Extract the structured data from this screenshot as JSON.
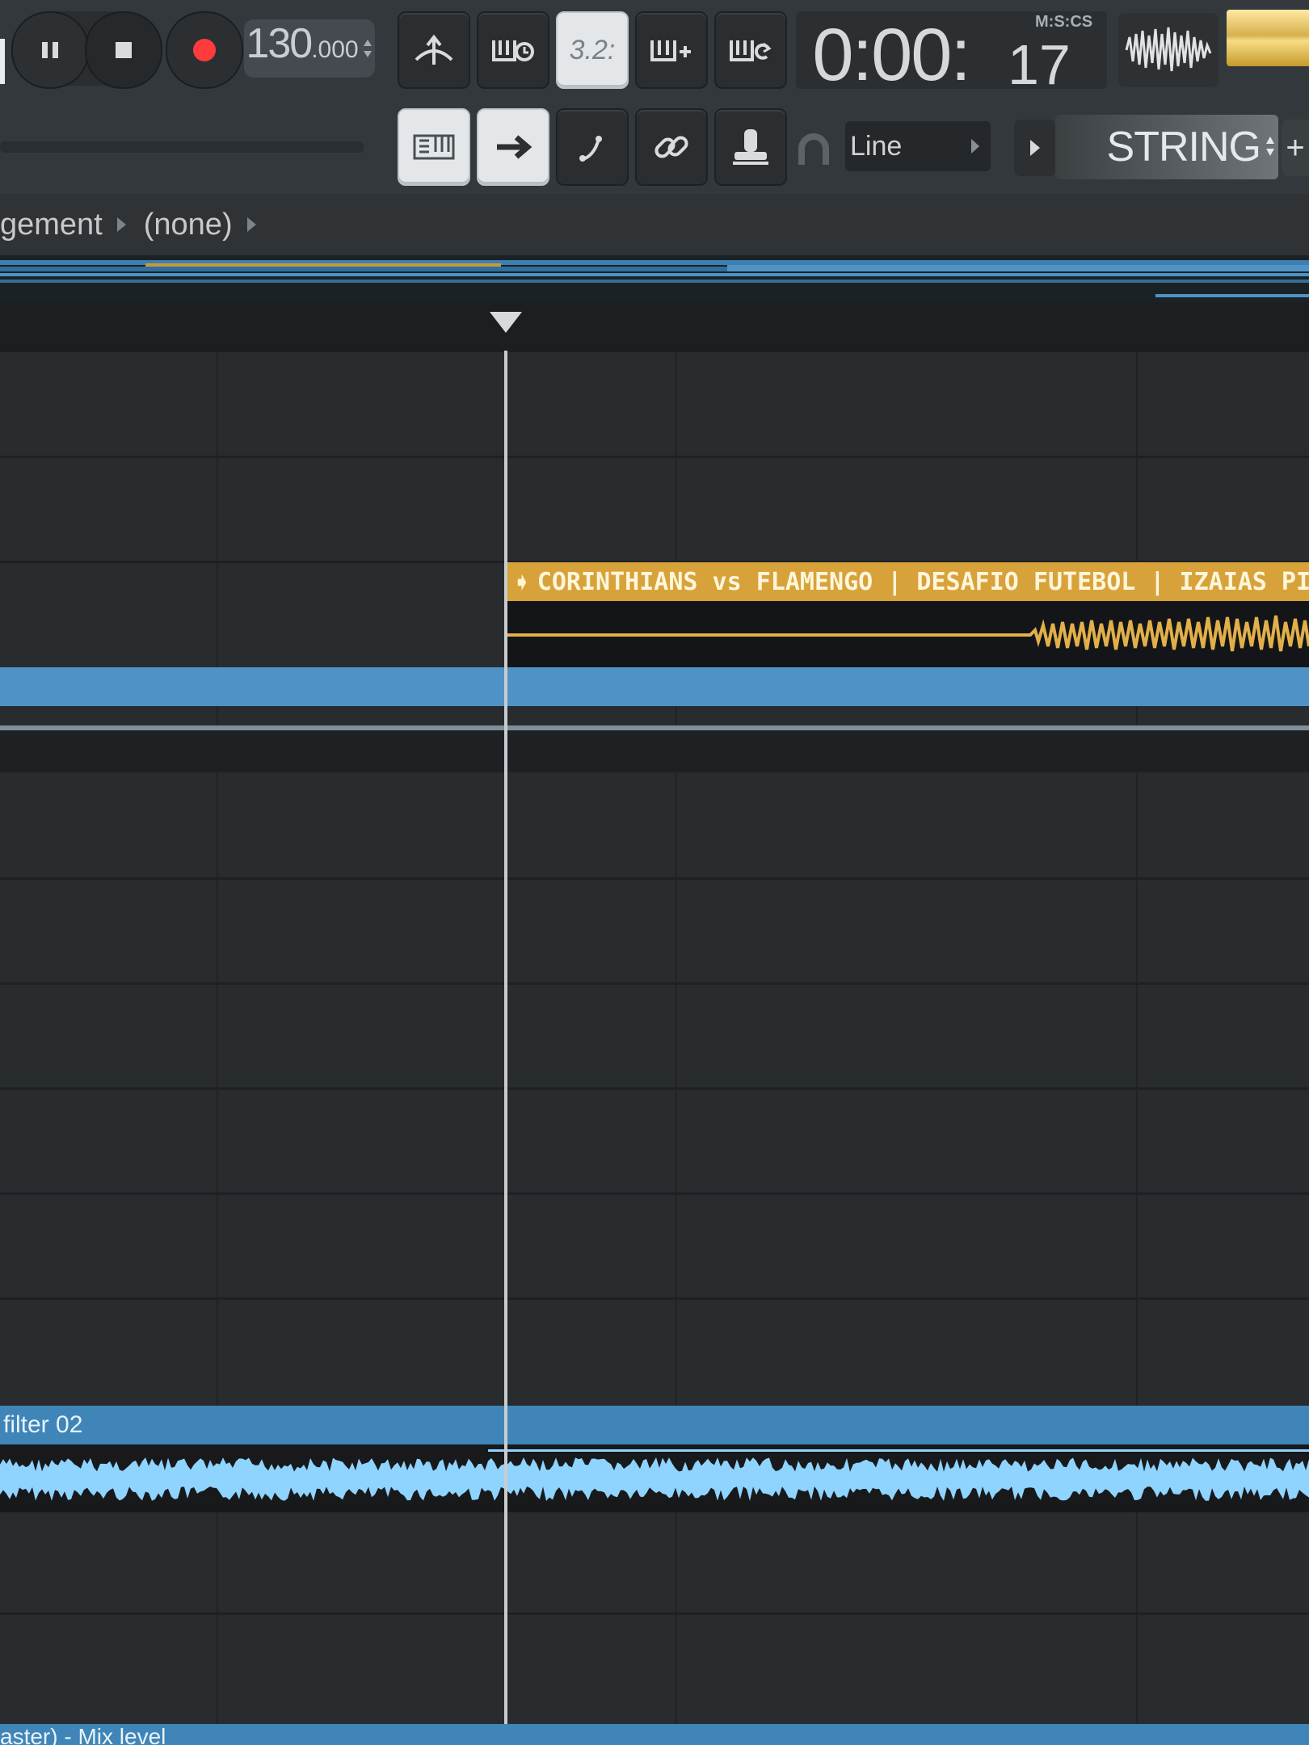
{
  "transport": {
    "tempo_main": "130",
    "tempo_fraction": ".000",
    "time_display_main": "0:00:",
    "time_display_seconds": "17",
    "time_format": "M:S:CS"
  },
  "toolbar": {
    "snap_mode": "Line",
    "pattern_name": "STRING",
    "plus_label": "+",
    "song_position_icon_text": "3.2:"
  },
  "breadcrumb": {
    "items": [
      "gement",
      "(none)"
    ]
  },
  "clips": {
    "audio_clip_title": "CORINTHIANS vs FLAMENGO | DESAFIO FUTEBOL | IZAIAS PIAUI_",
    "automation_clip_title": "filter 02",
    "bottom_clip_title": "aster) - Mix level"
  },
  "colors": {
    "accent_gold": "#d8a23a",
    "clip_blue": "#4f93c6",
    "waveform_blue": "#8fd3ff",
    "background": "#262a2d"
  },
  "icons": [
    "pause-icon",
    "stop-icon",
    "record-icon",
    "metronome-icon",
    "wait-for-input-icon",
    "countdown-icon",
    "step-edit-icon",
    "loop-record-icon",
    "piano-roll-icon",
    "arrow-right-icon",
    "slide-icon",
    "link-icon",
    "stamp-icon",
    "magnet-icon",
    "triangle-right-icon"
  ]
}
